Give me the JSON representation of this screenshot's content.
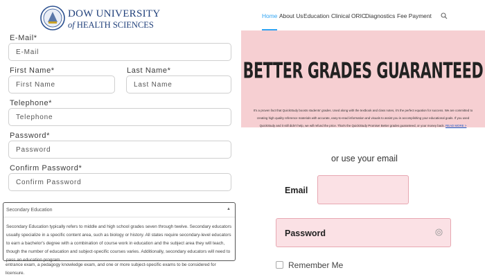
{
  "header": {
    "logo": {
      "line1": "DOW UNIVERSITY",
      "line2_prefix": "of",
      "line2": "HEALTH SCIENCES"
    },
    "nav": [
      "Home",
      "About Us",
      "Education",
      "Clinical",
      "ORIC",
      "Diagnostics",
      "Fee Payment"
    ],
    "active_nav": "Home",
    "accent_color": "#2ea3f2"
  },
  "form": {
    "email": {
      "label": "E-Mail*",
      "placeholder": "E-Mail"
    },
    "first_name": {
      "label": "First Name*",
      "placeholder": "First Name"
    },
    "last_name": {
      "label": "Last Name*",
      "placeholder": "Last Name"
    },
    "telephone": {
      "label": "Telephone*",
      "placeholder": "Telephone"
    },
    "password": {
      "label": "Password*",
      "placeholder": "Password"
    },
    "confirm_password": {
      "label": "Confirm Password*",
      "placeholder": "Confirm Password"
    }
  },
  "accordion": {
    "title": "Secondary Education",
    "body": "Secondary Education typically refers to middle and high school grades seven through twelve. Secondary educators usually specialize in a specific content area, such as biology or history. All states require secondary-level educators to earn a bachelor's degree with a combination of course work in education and the subject area they will teach, though the number of education and subject-specific courses varies. Additionally, secondary educators will need to pass an education program",
    "overflow": "entrance exam, a pedagogy knowledge exam, and one or more subject-specific exams to be considered for licensure."
  },
  "banner": {
    "title": "BETTER GRADES GUARANTEED",
    "text": "It's a proven fact that QuickStudy boosts students' grades. Used along with the textbook and class notes, it's the perfect equation for success. We are committed to creating high quality reference materials with accurate, easy-to-read information and visuals to assist you in accomplishing your educational goals. If you used QuickStudy and it still didn't help, we will refund the price. That's the QuickStudy Promise! Better grades guaranteed, or your money back.",
    "link": "READ MORE >",
    "background": "#f6cfd2"
  },
  "login": {
    "or_text": "or use your email",
    "email_label": "Email",
    "password_label": "Password",
    "remember_label": "Remember Me",
    "field_bg": "#fbe1e5"
  }
}
